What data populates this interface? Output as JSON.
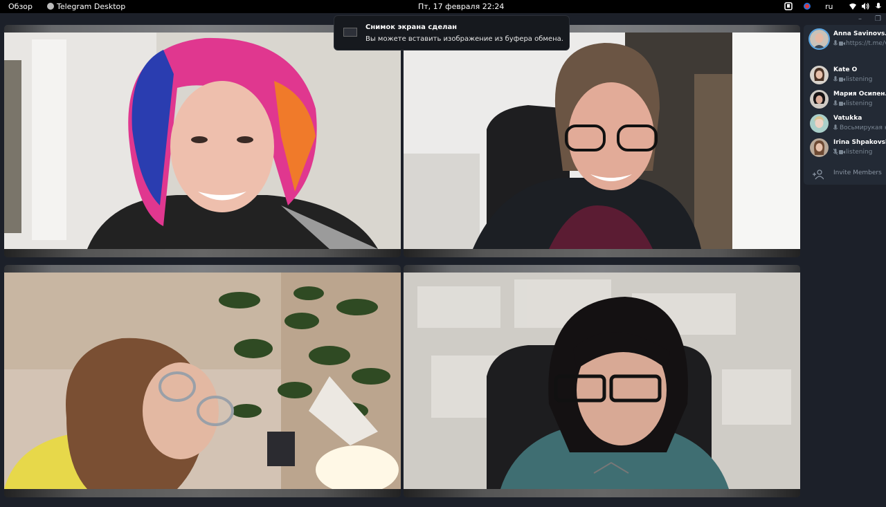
{
  "system_bar": {
    "overview": "Обзор",
    "app_name": "Telegram Desktop",
    "datetime": "Пт, 17 февраля  22:24",
    "language": "ru"
  },
  "notification": {
    "title": "Снимок экрана сделан",
    "message": "Вы можете вставить изображение из буфера обмена."
  },
  "members": [
    {
      "name": "Anna Savinovs…",
      "status": "https://t.me/v",
      "speaking": true,
      "muted": false
    },
    {
      "name": "Kate O",
      "status": "listening",
      "speaking": false,
      "muted": false
    },
    {
      "name": "Мария Осипен…",
      "status": "listening",
      "speaking": false,
      "muted": false
    },
    {
      "name": "Vatukka",
      "status": "Восьмирукая кр",
      "speaking": false,
      "muted": false
    },
    {
      "name": "Irina Shpakovskay",
      "status": "listening",
      "speaking": false,
      "muted": true
    }
  ],
  "invite_label": "Invite Members",
  "window_controls": {
    "minimize": "–",
    "restore": "❐"
  }
}
